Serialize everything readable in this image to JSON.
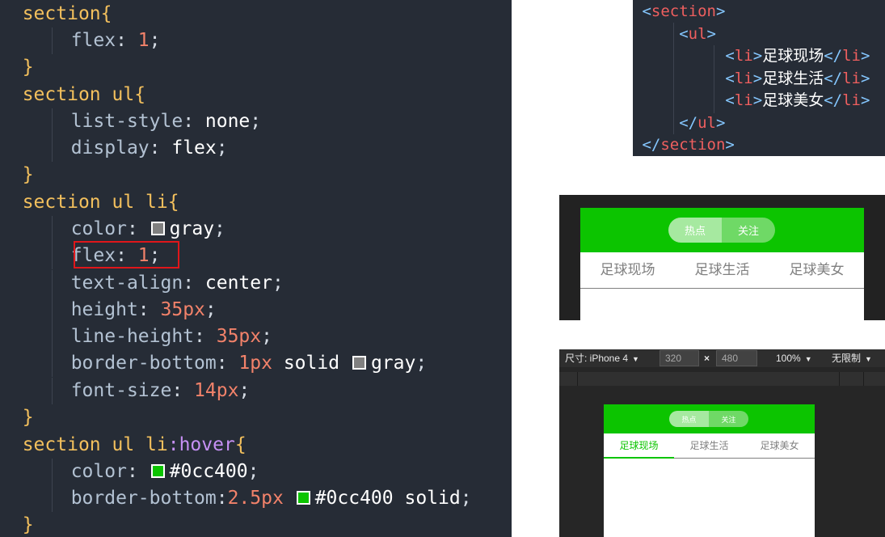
{
  "css_code": {
    "rule1": {
      "selector": "section",
      "brace_open": "{",
      "props": [
        {
          "name": "flex",
          "colon": ": ",
          "value": "1",
          "semi": ";"
        }
      ],
      "brace_close": "}"
    },
    "rule2": {
      "selector": "section ul",
      "brace_open": "{",
      "props": [
        {
          "name": "list-style",
          "colon": ": ",
          "value": "none",
          "semi": ";"
        },
        {
          "name": "display",
          "colon": ": ",
          "value": "flex",
          "semi": ";"
        }
      ],
      "brace_close": "}"
    },
    "rule3": {
      "selector": "section ul li",
      "brace_open": "{",
      "props": [
        {
          "name": "color",
          "colon": ": ",
          "value": "gray",
          "semi": ";",
          "swatch_color": "#808080"
        },
        {
          "name": "flex",
          "colon": ": ",
          "value": "1",
          "semi": ";",
          "highlighted": true
        },
        {
          "name": "text-align",
          "colon": ": ",
          "value": "center",
          "semi": ";"
        },
        {
          "name": "height",
          "colon": ": ",
          "value": "35px",
          "semi": ";"
        },
        {
          "name": "line-height",
          "colon": ": ",
          "value": "35px",
          "semi": ";"
        },
        {
          "name": "border-bottom",
          "colon": ": ",
          "value_num": "1px",
          "value_kw": "solid",
          "value_color": "gray",
          "semi": ";",
          "swatch_color": "#808080"
        },
        {
          "name": "font-size",
          "colon": ": ",
          "value": "14px",
          "semi": ";"
        }
      ],
      "brace_close": "}"
    },
    "rule4": {
      "selector": "section ul li",
      "pseudo": ":hover",
      "brace_open": "{",
      "props": [
        {
          "name": "color",
          "colon": ": ",
          "value": "#0cc400",
          "semi": ";",
          "swatch_color": "#0cc400"
        },
        {
          "name": "border-bottom",
          "colon": ":",
          "value_num": "2.5px",
          "value_color": "#0cc400",
          "value_kw": "solid",
          "semi": ";",
          "swatch_color": "#0cc400"
        }
      ],
      "brace_close": "}"
    }
  },
  "html_code": {
    "lines": [
      {
        "open": "<",
        "tag": "section",
        "close": ">"
      },
      {
        "open": "<",
        "tag": "ul",
        "close": ">"
      },
      {
        "open": "<",
        "tag": "li",
        "close": ">",
        "text": "足球现场",
        "end_open": "</",
        "end_tag": "li",
        "end_close": ">"
      },
      {
        "open": "<",
        "tag": "li",
        "close": ">",
        "text": "足球生活",
        "end_open": "</",
        "end_tag": "li",
        "end_close": ">"
      },
      {
        "open": "<",
        "tag": "li",
        "close": ">",
        "text": "足球美女",
        "end_open": "</",
        "end_tag": "li",
        "end_close": ">"
      },
      {
        "open": "</",
        "tag": "ul",
        "close": ">"
      },
      {
        "open": "</",
        "tag": "section",
        "close": ">"
      }
    ]
  },
  "preview_page": {
    "toggle": [
      "热点",
      "关注"
    ],
    "tabs": [
      "足球现场",
      "足球生活",
      "足球美女"
    ],
    "accent_color": "#0cc400"
  },
  "device_preview": {
    "size_label": "尺寸: iPhone 4",
    "width_value": "320",
    "times": "×",
    "height_value": "480",
    "zoom": "100%",
    "throttle": "无限制",
    "toggle": [
      "热点",
      "关注"
    ],
    "tabs": [
      "足球现场",
      "足球生活",
      "足球美女"
    ],
    "active_tab": "足球现场"
  }
}
